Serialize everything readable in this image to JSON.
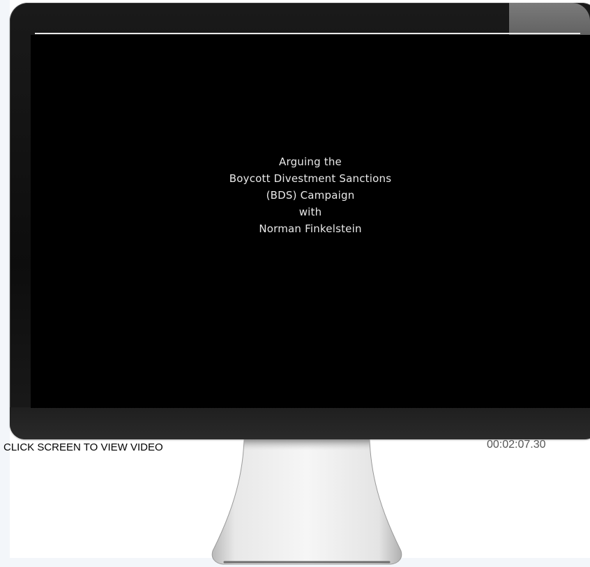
{
  "video": {
    "title_lines": [
      "Arguing the",
      "Boycott Divestment Sanctions",
      "(BDS) Campaign",
      "with",
      "Norman Finkelstein"
    ]
  },
  "instruction": "CLICK SCREEN TO VIEW VIDEO",
  "timecode": "00:02:07.30"
}
